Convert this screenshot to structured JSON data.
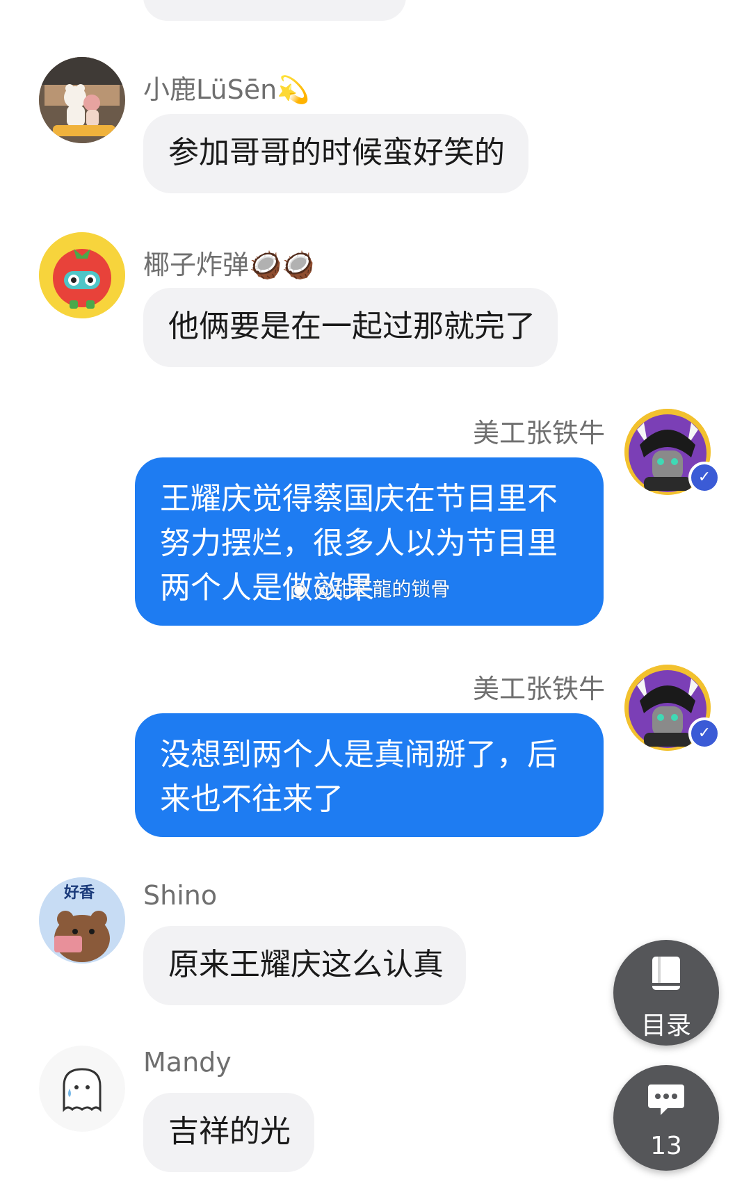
{
  "messages": [
    {
      "side": "left",
      "name": "小鹿LüSēn",
      "emoji": "💫",
      "text": "参加哥哥的时候蛮好笑的",
      "avatar": "photo-avatar"
    },
    {
      "side": "left",
      "name": "椰子炸弹",
      "emoji": "🥥🥥",
      "text": "他俩要是在一起过那就完了",
      "avatar": "tomato-avatar"
    },
    {
      "side": "right",
      "name": "美工张铁牛",
      "lines": [
        "王耀庆觉得蔡国庆在节目里不",
        "努力摆烂，很多人以为节目里",
        "两个人是做效果"
      ],
      "avatar": "horned-character-avatar",
      "verified": true
    },
    {
      "side": "right",
      "name": "美工张铁牛",
      "lines": [
        "没想到两个人是真闹掰了，后",
        "来也不往来了"
      ],
      "avatar": "horned-character-avatar",
      "verified": true
    },
    {
      "side": "left",
      "name": "Shino",
      "text": "原来王耀庆这么认真",
      "avatar": "bear-avatar",
      "avatar_text": "好香"
    },
    {
      "side": "left",
      "name": "Mandy",
      "text": "吉祥的光",
      "avatar": "ghost-avatar"
    }
  ],
  "watermark": "@甜芒龍的锁骨",
  "float": {
    "toc_label": "目录",
    "comment_count": "13"
  },
  "colors": {
    "accent": "#1e7cf2",
    "bubble_gray": "#f2f2f4",
    "float_bg": "#555659"
  }
}
